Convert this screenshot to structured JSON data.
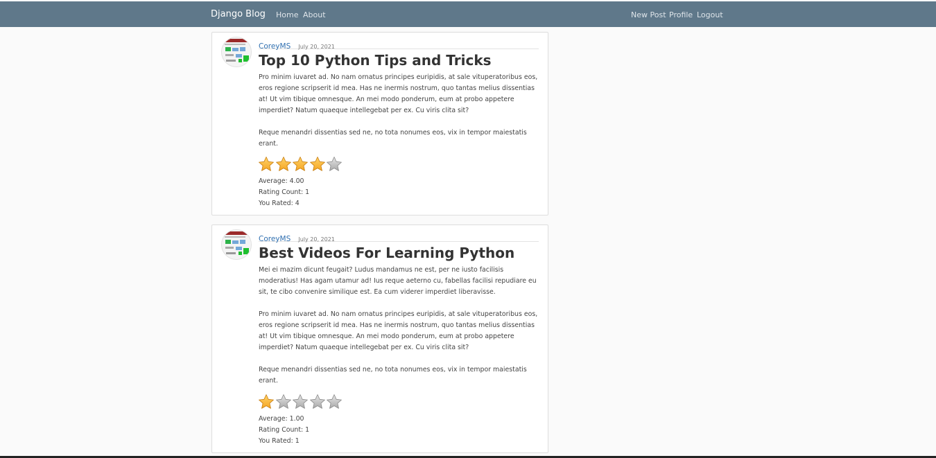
{
  "navbar": {
    "brand": "Django Blog",
    "left_links": [
      "Home",
      "About"
    ],
    "right_links": [
      "New Post",
      "Profile",
      "Logout"
    ]
  },
  "colors": {
    "navbar": "#5f788a",
    "link": "#2f6fb0",
    "star_filled": "#f5a623",
    "star_empty": "#a9a9a9"
  },
  "posts": [
    {
      "author": "CoreyMS",
      "date": "July 20, 2021",
      "title": "Top 10 Python Tips and Tricks",
      "paragraph1": "Pro minim iuvaret ad. No nam ornatus principes euripidis, at sale vituperatoribus eos, eros regione scripserit id mea. Has ne inermis nostrum, quo tantas melius dissentias at! Ut vim tibique omnesque. An mei modo ponderum, eum at probo appetere imperdiet? Natum quaeque intellegebat per ex. Cu viris clita sit?",
      "paragraph2": "Reque menandri dissentias sed ne, no tota nonumes eos, vix in tempor maiestatis erant.",
      "rating_stars": 4,
      "average": "Average: 4.00",
      "count": "Rating Count: 1",
      "you_rated": "You Rated: 4"
    },
    {
      "author": "CoreyMS",
      "date": "July 20, 2021",
      "title": "Best Videos For Learning Python",
      "paragraph1": "Mei ei mazim dicunt feugait? Ludus mandamus ne est, per ne iusto facilisis moderatius! Has agam utamur ad! Ius reque aeterno cu, fabellas facilisi repudiare eu sit, te cibo convenire similique est. Ea cum viderer imperdiet liberavisse.",
      "paragraph2": "Pro minim iuvaret ad. No nam ornatus principes euripidis, at sale vituperatoribus eos, eros regione scripserit id mea. Has ne inermis nostrum, quo tantas melius dissentias at! Ut vim tibique omnesque. An mei modo ponderum, eum at probo appetere imperdiet? Natum quaeque intellegebat per ex. Cu viris clita sit?",
      "paragraph3": "Reque menandri dissentias sed ne, no tota nonumes eos, vix in tempor maiestatis erant.",
      "rating_stars": 1,
      "average": "Average: 1.00",
      "count": "Rating Count: 1",
      "you_rated": "You Rated: 1"
    }
  ]
}
